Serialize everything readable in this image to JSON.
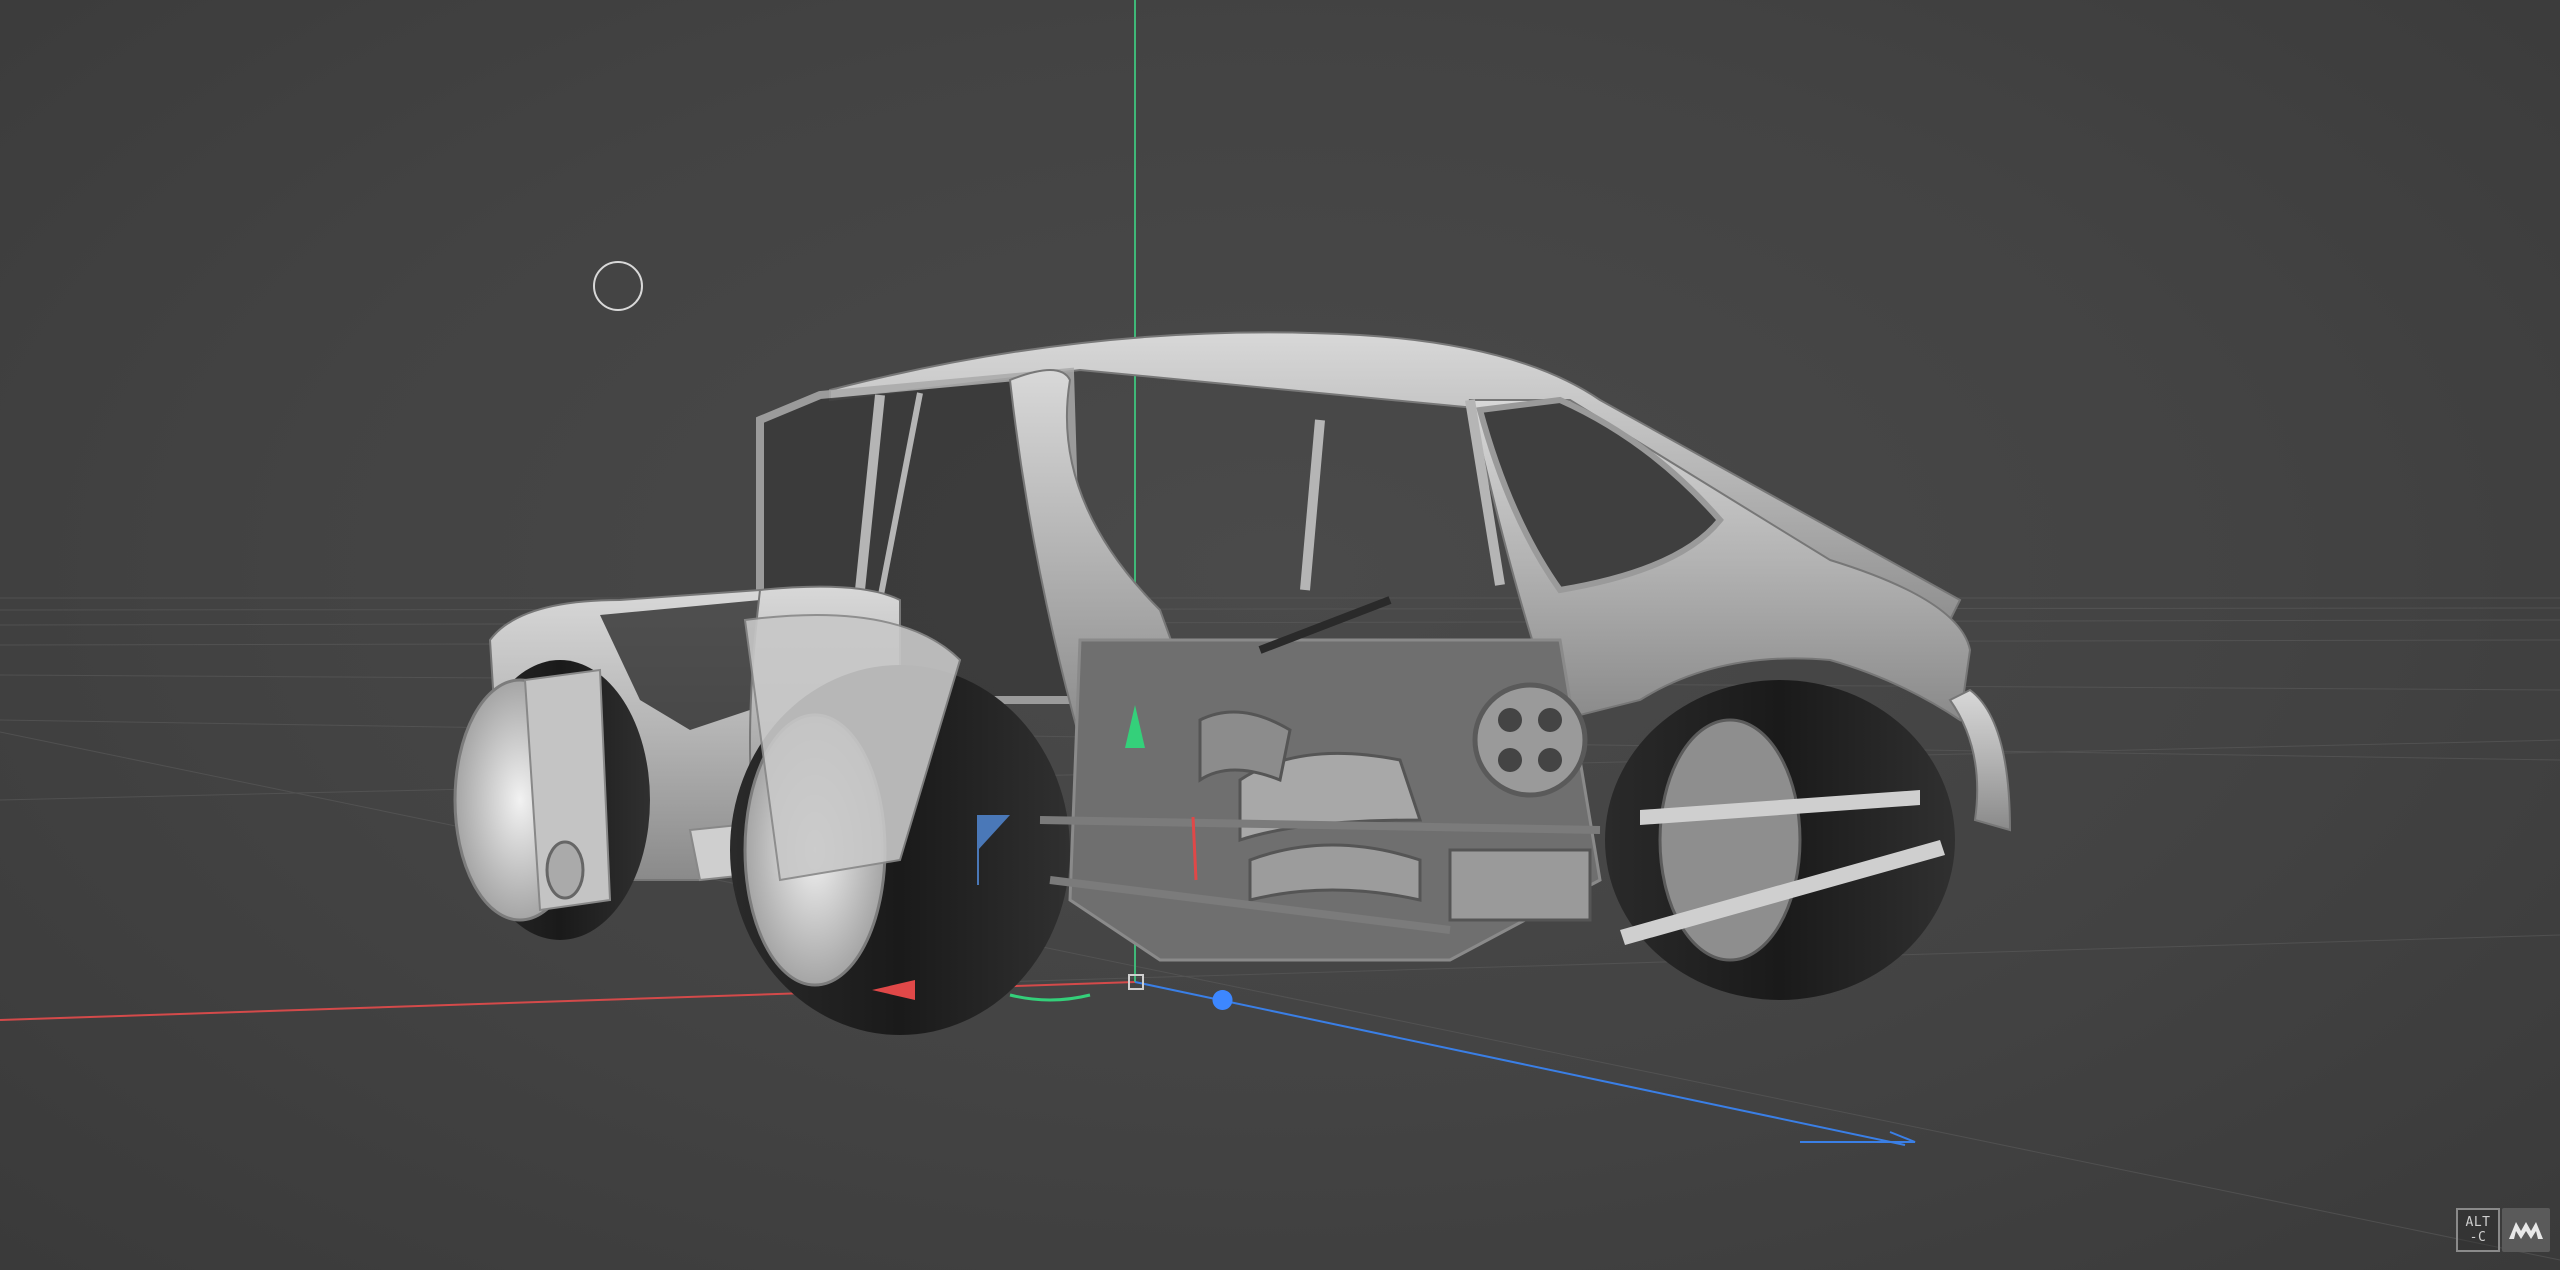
{
  "viewport": {
    "name": "3D viewport",
    "model": "car-wireframe-render",
    "colors": {
      "background": "#434343",
      "axis_x": "#e04848",
      "axis_y": "#3fd17a",
      "axis_z": "#3d87ff",
      "body": "#bdbdbd",
      "tire": "#1d1d1d"
    }
  },
  "overlay": {
    "key_hint_top": "ALT",
    "key_hint_bottom": "-C",
    "logo_icon": "brand-logo-icon"
  }
}
